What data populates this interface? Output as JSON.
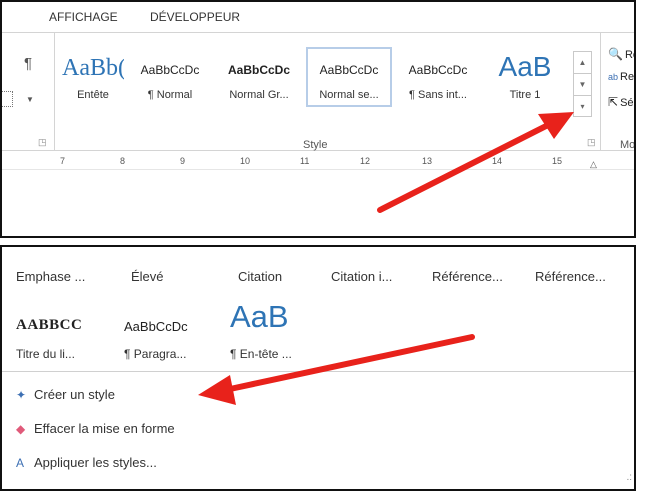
{
  "panel1": {
    "tabs": [
      "AFFICHAGE",
      "DÉVELOPPEUR"
    ],
    "pilcrow": "¶",
    "gallery": [
      {
        "sample": "AaBb(",
        "label": "Entête",
        "style": "big1"
      },
      {
        "sample": "AaBbCcDc",
        "label": "¶ Normal",
        "style": "small"
      },
      {
        "sample": "AaBbCcDc",
        "label": "Normal Gr...",
        "style": "bold"
      },
      {
        "sample": "AaBbCcDc",
        "label": "Normal se...",
        "style": "small",
        "selected": true
      },
      {
        "sample": "AaBbCcDc",
        "label": "¶ Sans int...",
        "style": "small"
      },
      {
        "sample": "AaB",
        "label": "Titre 1",
        "style": "big2"
      }
    ],
    "group_label": "Style",
    "group_label_right": "Mo",
    "right_commands": [
      {
        "icon": "find-icon",
        "glyph": "🔍",
        "label": "Re"
      },
      {
        "icon": "replace-icon",
        "glyph": "ab",
        "label": "Re"
      },
      {
        "icon": "select-icon",
        "glyph": "⇱",
        "label": "Sél"
      }
    ],
    "ruler_numbers": [
      "7",
      "8",
      "9",
      "10",
      "11",
      "12",
      "13",
      "14",
      "15"
    ]
  },
  "panel2": {
    "row1": [
      "Emphase ...",
      "Élevé",
      "Citation",
      "Citation i...",
      "Référence...",
      "Référence..."
    ],
    "row2": [
      {
        "sample": "AABBCC",
        "style": "smallcaps"
      },
      {
        "sample": "AaBbCcDc",
        "style": "small"
      },
      {
        "sample": "AaB",
        "style": "big"
      }
    ],
    "row3": [
      "Titre du li...",
      "¶ Paragra...",
      "¶ En-tête ..."
    ],
    "commands": [
      {
        "label": "Créer un style",
        "icon": "create-style-icon"
      },
      {
        "label": "Effacer la mise en forme",
        "icon": "eraser-icon"
      },
      {
        "label": "Appliquer les styles...",
        "icon": "apply-styles-icon"
      }
    ],
    "footer_dots": ".:"
  },
  "colors": {
    "arrow": "#e8221b",
    "heading_blue": "#2e74b5",
    "selected_border": "#b7cde8"
  }
}
